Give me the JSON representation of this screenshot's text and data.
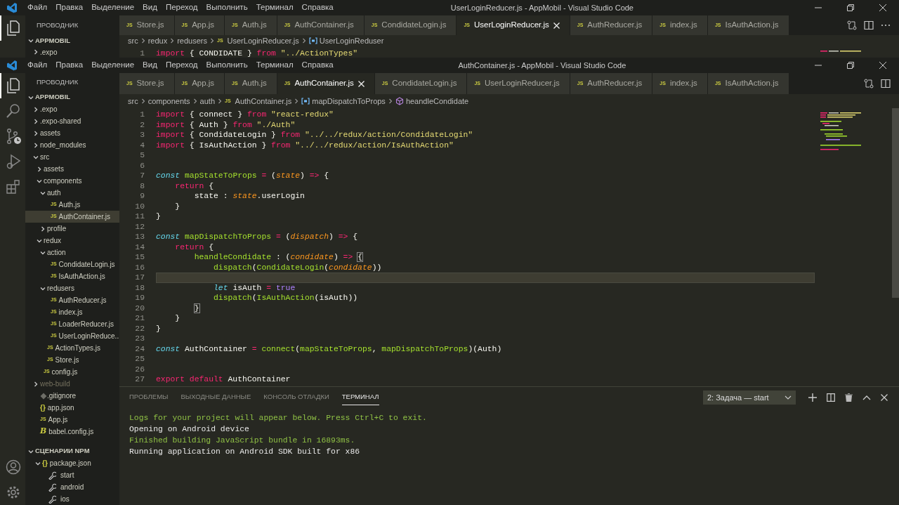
{
  "back_window": {
    "menu": [
      "Файл",
      "Правка",
      "Выделение",
      "Вид",
      "Переход",
      "Выполнить",
      "Терминал",
      "Справка"
    ],
    "title": "UserLoginReducer.js - AppMobil - Visual Studio Code",
    "sidebar": {
      "title": "ПРОВОДНИК",
      "root": {
        "label": "APPMOBIL",
        "expanded": true,
        "children": [
          {
            "label": ".expo",
            "kind": "folder",
            "expanded": false,
            "selected": false
          }
        ]
      }
    },
    "tabs": [
      {
        "label": "Store.js",
        "badge": "JS",
        "selected": false
      },
      {
        "label": "App.js",
        "badge": "JS",
        "selected": false
      },
      {
        "label": "Auth.js",
        "badge": "JS",
        "selected": false
      },
      {
        "label": "AuthContainer.js",
        "badge": "JS",
        "selected": false
      },
      {
        "label": "CondidateLogin.js",
        "badge": "JS",
        "selected": false
      },
      {
        "label": "UserLoginReducer.js",
        "badge": "JS",
        "selected": true
      },
      {
        "label": "AuthReducer.js",
        "badge": "JS",
        "selected": false
      },
      {
        "label": "index.js",
        "badge": "JS",
        "selected": false
      },
      {
        "label": "IsAuthAction.js",
        "badge": "JS",
        "selected": false
      }
    ],
    "breadcrumb": [
      {
        "label": "src",
        "kind": "folder"
      },
      {
        "label": "redux",
        "kind": "folder"
      },
      {
        "label": "redusers",
        "kind": "folder"
      },
      {
        "label": "UserLoginReducer.js",
        "kind": "js",
        "badge": "JS"
      },
      {
        "label": "UserLoginReduser",
        "kind": "variable"
      }
    ],
    "code": {
      "lines": [
        {
          "number": "1",
          "current": false,
          "tokens": [
            {
              "text": "import",
              "kind": "keyword"
            },
            {
              "text": " { CONDIDATE } ",
              "kind": "plain"
            },
            {
              "text": "from",
              "kind": "keyword"
            },
            {
              "text": " \"../ActionTypes\"",
              "kind": "string"
            }
          ]
        }
      ]
    }
  },
  "window": {
    "menu": [
      "Файл",
      "Правка",
      "Выделение",
      "Вид",
      "Переход",
      "Выполнить",
      "Терминал",
      "Справка"
    ],
    "title": "AuthContainer.js - AppMobil - Visual Studio Code",
    "sidebar": {
      "title": "ПРОВОДНИК",
      "root": {
        "label": "APPMOBIL",
        "expanded": true,
        "children": [
          {
            "label": ".expo",
            "kind": "folder",
            "expanded": false,
            "selected": false
          },
          {
            "label": ".expo-shared",
            "kind": "folder",
            "expanded": false,
            "selected": false
          },
          {
            "label": "assets",
            "kind": "folder",
            "expanded": false,
            "selected": false
          },
          {
            "label": "node_modules",
            "kind": "folder",
            "expanded": false,
            "selected": false
          },
          {
            "label": "src",
            "kind": "folder",
            "expanded": true,
            "selected": false,
            "children": [
              {
                "label": "assets",
                "kind": "folder",
                "expanded": false,
                "selected": false
              },
              {
                "label": "components",
                "kind": "folder",
                "expanded": true,
                "selected": false,
                "children": [
                  {
                    "label": "auth",
                    "kind": "folder",
                    "expanded": true,
                    "selected": false,
                    "children": [
                      {
                        "label": "Auth.js",
                        "kind": "js",
                        "badge": "JS",
                        "selected": false
                      },
                      {
                        "label": "AuthContainer.js",
                        "kind": "js",
                        "badge": "JS",
                        "selected": true
                      }
                    ]
                  },
                  {
                    "label": "profile",
                    "kind": "folder",
                    "expanded": false,
                    "selected": false
                  }
                ]
              },
              {
                "label": "redux",
                "kind": "folder",
                "expanded": true,
                "selected": false,
                "children": [
                  {
                    "label": "action",
                    "kind": "folder",
                    "expanded": true,
                    "selected": false,
                    "children": [
                      {
                        "label": "CondidateLogin.js",
                        "kind": "js",
                        "badge": "JS",
                        "selected": false
                      },
                      {
                        "label": "IsAuthAction.js",
                        "kind": "js",
                        "badge": "JS",
                        "selected": false
                      }
                    ]
                  },
                  {
                    "label": "redusers",
                    "kind": "folder",
                    "expanded": true,
                    "selected": false,
                    "children": [
                      {
                        "label": "AuthReducer.js",
                        "kind": "js",
                        "badge": "JS",
                        "selected": false
                      },
                      {
                        "label": "index.js",
                        "kind": "js",
                        "badge": "JS",
                        "selected": false
                      },
                      {
                        "label": "LoaderReducer.js",
                        "kind": "js",
                        "badge": "JS",
                        "selected": false
                      },
                      {
                        "label": "UserLoginReduce...",
                        "kind": "js",
                        "badge": "JS",
                        "selected": false
                      }
                    ]
                  },
                  {
                    "label": "ActionTypes.js",
                    "kind": "js",
                    "badge": "JS",
                    "selected": false
                  },
                  {
                    "label": "Store.js",
                    "kind": "js",
                    "badge": "JS",
                    "selected": false
                  }
                ]
              },
              {
                "label": "config.js",
                "kind": "js",
                "badge": "JS",
                "selected": false
              }
            ]
          },
          {
            "label": "web-build",
            "kind": "folder",
            "expanded": false,
            "selected": false,
            "ignored": true
          },
          {
            "label": ".gitignore",
            "kind": "git",
            "selected": false
          },
          {
            "label": "app.json",
            "kind": "json",
            "badge": "{}",
            "selected": false
          },
          {
            "label": "App.js",
            "kind": "js",
            "badge": "JS",
            "selected": false
          },
          {
            "label": "babel.config.js",
            "kind": "babel",
            "badge": "B",
            "selected": false
          }
        ]
      },
      "npm": {
        "title": "СЦЕНАРИИ NPM",
        "expanded": true,
        "package": {
          "label": "package.json",
          "badge": "{}",
          "expanded": true,
          "scripts": [
            "start",
            "android",
            "ios"
          ]
        }
      }
    },
    "tabs": [
      {
        "label": "Store.js",
        "badge": "JS",
        "selected": false
      },
      {
        "label": "App.js",
        "badge": "JS",
        "selected": false
      },
      {
        "label": "Auth.js",
        "badge": "JS",
        "selected": false
      },
      {
        "label": "AuthContainer.js",
        "badge": "JS",
        "selected": true
      },
      {
        "label": "CondidateLogin.js",
        "badge": "JS",
        "selected": false
      },
      {
        "label": "UserLoginReducer.js",
        "badge": "JS",
        "selected": false
      },
      {
        "label": "AuthReducer.js",
        "badge": "JS",
        "selected": false
      },
      {
        "label": "index.js",
        "badge": "JS",
        "selected": false
      },
      {
        "label": "IsAuthAction.js",
        "badge": "JS",
        "selected": false
      }
    ],
    "breadcrumb": [
      {
        "label": "src",
        "kind": "folder"
      },
      {
        "label": "components",
        "kind": "folder"
      },
      {
        "label": "auth",
        "kind": "folder"
      },
      {
        "label": "AuthContainer.js",
        "kind": "js",
        "badge": "JS"
      },
      {
        "label": "mapDispatchToProps",
        "kind": "variable"
      },
      {
        "label": "heandleCondidate",
        "kind": "method"
      }
    ],
    "code": {
      "lines": [
        {
          "number": "1",
          "current": false,
          "tokens": [
            {
              "text": "import",
              "kind": "keyword"
            },
            {
              "text": " { connect } ",
              "kind": "plain"
            },
            {
              "text": "from",
              "kind": "keyword"
            },
            {
              "text": " \"react-redux\"",
              "kind": "string"
            }
          ]
        },
        {
          "number": "2",
          "current": false,
          "tokens": [
            {
              "text": "import",
              "kind": "keyword"
            },
            {
              "text": " { Auth } ",
              "kind": "plain"
            },
            {
              "text": "from",
              "kind": "keyword"
            },
            {
              "text": " \"./Auth\"",
              "kind": "string"
            }
          ]
        },
        {
          "number": "3",
          "current": false,
          "tokens": [
            {
              "text": "import",
              "kind": "keyword"
            },
            {
              "text": " { CondidateLogin } ",
              "kind": "plain"
            },
            {
              "text": "from",
              "kind": "keyword"
            },
            {
              "text": " \"../../redux/action/CondidateLogin\"",
              "kind": "string"
            }
          ]
        },
        {
          "number": "4",
          "current": false,
          "tokens": [
            {
              "text": "import",
              "kind": "keyword"
            },
            {
              "text": " { IsAuthAction } ",
              "kind": "plain"
            },
            {
              "text": "from",
              "kind": "keyword"
            },
            {
              "text": " \"../../redux/action/IsAuthAction\"",
              "kind": "string"
            }
          ]
        },
        {
          "number": "5",
          "current": false
        },
        {
          "number": "6",
          "current": false
        },
        {
          "number": "7",
          "current": false,
          "tokens": [
            {
              "text": "const",
              "kind": "storage"
            },
            {
              "text": " mapStateToProps",
              "kind": "func"
            },
            {
              "text": " =",
              "kind": "keyword"
            },
            {
              "text": " (",
              "kind": "plain"
            },
            {
              "text": "state",
              "kind": "param"
            },
            {
              "text": ") ",
              "kind": "plain"
            },
            {
              "text": "=>",
              "kind": "keyword"
            },
            {
              "text": " {",
              "kind": "plain"
            }
          ]
        },
        {
          "number": "8",
          "current": false,
          "tokens": [
            {
              "text": "    return",
              "kind": "keyword"
            },
            {
              "text": " {",
              "kind": "plain"
            }
          ]
        },
        {
          "number": "9",
          "current": false,
          "tokens": [
            {
              "text": "        state : ",
              "kind": "plain"
            },
            {
              "text": "state",
              "kind": "param"
            },
            {
              "text": ".userLogin",
              "kind": "plain"
            }
          ]
        },
        {
          "number": "10",
          "current": false,
          "tokens": [
            {
              "text": "    }",
              "kind": "plain"
            }
          ]
        },
        {
          "number": "11",
          "current": false,
          "tokens": [
            {
              "text": "}",
              "kind": "plain"
            }
          ]
        },
        {
          "number": "12",
          "current": false
        },
        {
          "number": "13",
          "current": false,
          "tokens": [
            {
              "text": "const",
              "kind": "storage"
            },
            {
              "text": " mapDispatchToProps",
              "kind": "func"
            },
            {
              "text": " =",
              "kind": "keyword"
            },
            {
              "text": " (",
              "kind": "plain"
            },
            {
              "text": "dispatch",
              "kind": "param"
            },
            {
              "text": ") ",
              "kind": "plain"
            },
            {
              "text": "=>",
              "kind": "keyword"
            },
            {
              "text": " {",
              "kind": "plain"
            }
          ]
        },
        {
          "number": "14",
          "current": false,
          "tokens": [
            {
              "text": "    return",
              "kind": "keyword"
            },
            {
              "text": " {",
              "kind": "plain"
            }
          ]
        },
        {
          "number": "15",
          "current": false,
          "tokens": [
            {
              "text": "        heandleCondidate",
              "kind": "func"
            },
            {
              "text": " : (",
              "kind": "plain"
            },
            {
              "text": "condidate",
              "kind": "param"
            },
            {
              "text": ") ",
              "kind": "plain"
            },
            {
              "text": "=> ",
              "kind": "keyword"
            },
            {
              "text": "{",
              "kind": "bracket_match"
            }
          ]
        },
        {
          "number": "16",
          "current": false,
          "tokens": [
            {
              "text": "            dispatch",
              "kind": "func"
            },
            {
              "text": "(",
              "kind": "plain"
            },
            {
              "text": "CondidateLogin",
              "kind": "func"
            },
            {
              "text": "(",
              "kind": "plain"
            },
            {
              "text": "condidate",
              "kind": "param"
            },
            {
              "text": "))",
              "kind": "plain"
            }
          ]
        },
        {
          "number": "17",
          "current": true
        },
        {
          "number": "18",
          "current": false,
          "tokens": [
            {
              "text": "            let",
              "kind": "storage"
            },
            {
              "text": " isAuth ",
              "kind": "plain"
            },
            {
              "text": "=",
              "kind": "keyword"
            },
            {
              "text": " true",
              "kind": "constant"
            }
          ]
        },
        {
          "number": "19",
          "current": false,
          "tokens": [
            {
              "text": "            dispatch",
              "kind": "func"
            },
            {
              "text": "(",
              "kind": "plain"
            },
            {
              "text": "IsAuthAction",
              "kind": "func"
            },
            {
              "text": "(isAuth))",
              "kind": "plain"
            }
          ]
        },
        {
          "number": "20",
          "current": false,
          "tokens": [
            {
              "text": "        }",
              "kind": "bracket_match"
            }
          ]
        },
        {
          "number": "21",
          "current": false,
          "tokens": [
            {
              "text": "    }",
              "kind": "plain"
            }
          ]
        },
        {
          "number": "22",
          "current": false,
          "tokens": [
            {
              "text": "}",
              "kind": "plain"
            }
          ]
        },
        {
          "number": "23",
          "current": false
        },
        {
          "number": "24",
          "current": false,
          "tokens": [
            {
              "text": "const",
              "kind": "storage"
            },
            {
              "text": " AuthContainer ",
              "kind": "plain"
            },
            {
              "text": "=",
              "kind": "keyword"
            },
            {
              "text": " connect",
              "kind": "func"
            },
            {
              "text": "(",
              "kind": "plain"
            },
            {
              "text": "mapStateToProps",
              "kind": "func"
            },
            {
              "text": ", ",
              "kind": "plain"
            },
            {
              "text": "mapDispatchToProps",
              "kind": "func"
            },
            {
              "text": ")(Auth)",
              "kind": "plain"
            }
          ]
        },
        {
          "number": "25",
          "current": false
        },
        {
          "number": "26",
          "current": false
        },
        {
          "number": "27",
          "current": false,
          "tokens": [
            {
              "text": "export",
              "kind": "keyword"
            },
            {
              "text": " default",
              "kind": "keyword"
            },
            {
              "text": " AuthContainer",
              "kind": "plain"
            }
          ]
        }
      ]
    },
    "panel": {
      "tabs": [
        {
          "label": "ПРОБЛЕМЫ",
          "selected": false
        },
        {
          "label": "ВЫХОДНЫЕ ДАННЫЕ",
          "selected": false
        },
        {
          "label": "КОНСОЛЬ ОТЛАДКИ",
          "selected": false
        },
        {
          "label": "ТЕРМИНАЛ",
          "selected": true
        }
      ],
      "terminal_select": "2: Задача — start",
      "terminal_lines": [
        {
          "text": "Logs for your project will appear below. Press Ctrl+C to exit.",
          "kind": "info"
        },
        {
          "text": "Opening on Android device",
          "kind": "plain"
        },
        {
          "text": "Finished building JavaScript bundle in 16893ms.",
          "kind": "info"
        },
        {
          "text": "Running application on Android SDK built for x86",
          "kind": "plain"
        }
      ]
    }
  }
}
